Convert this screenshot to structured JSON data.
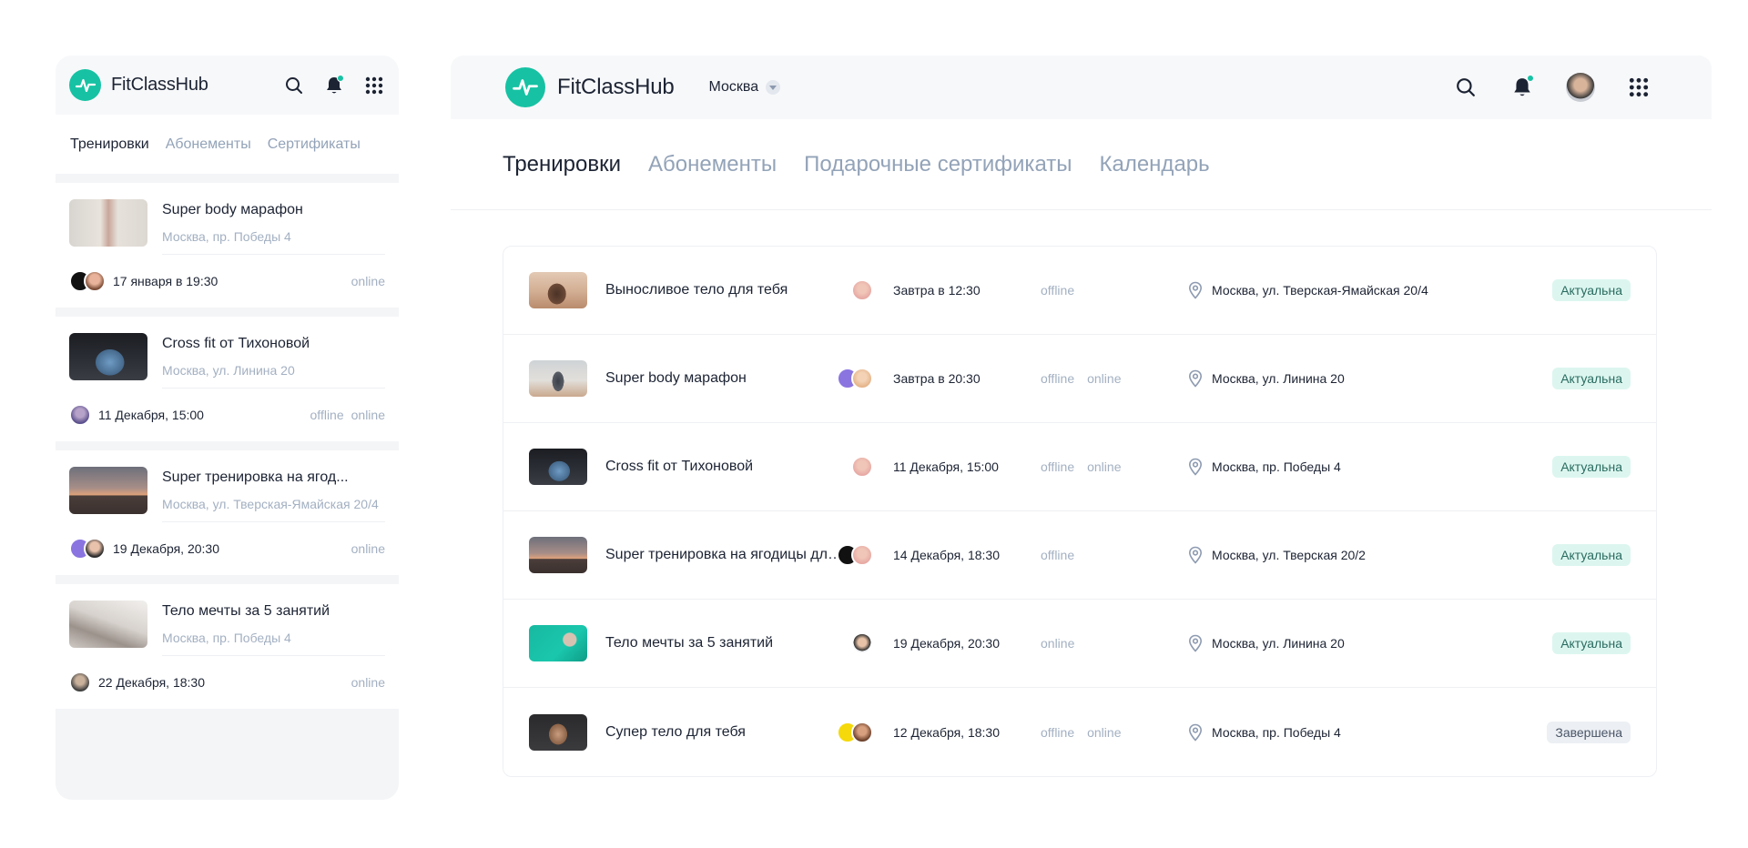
{
  "brand": {
    "name": "FitClassHub",
    "accent": "#16c2a3"
  },
  "icons": {
    "search": "search-icon",
    "bell": "bell-icon",
    "apps": "grid-icon",
    "location": "location-pin-icon",
    "caret": "chevron-down-icon"
  },
  "mobile": {
    "tabs": [
      {
        "label": "Тренировки",
        "active": true
      },
      {
        "label": "Абонементы",
        "active": false
      },
      {
        "label": "Сертификаты",
        "active": false
      }
    ],
    "items": [
      {
        "title": "Super body марафон",
        "address": "Москва, пр. Победы 4",
        "date": "17 января в 19:30",
        "modes": [
          "online"
        ]
      },
      {
        "title": "Cross fit от Тихоновой",
        "address": "Москва, ул. Линина 20",
        "date": "11 Декабря, 15:00",
        "modes": [
          "offline",
          "online"
        ]
      },
      {
        "title": "Super тренировка на ягод...",
        "address": "Москва, ул. Тверская-Ямайская 20/4",
        "date": "19 Декабря, 20:30",
        "modes": [
          "online"
        ]
      },
      {
        "title": "Тело мечты за 5 занятий",
        "address": "Москва, пр. Победы 4",
        "date": "22 Декабря, 18:30",
        "modes": [
          "online"
        ]
      }
    ]
  },
  "desktop": {
    "city": "Москва",
    "tabs": [
      {
        "label": "Тренировки",
        "active": true
      },
      {
        "label": "Абонементы",
        "active": false
      },
      {
        "label": "Подарочные сертификаты",
        "active": false
      },
      {
        "label": "Календарь",
        "active": false
      }
    ],
    "rows": [
      {
        "title": "Выносливое тело для тебя",
        "when": "Завтра в 12:30",
        "mode1": "offline",
        "mode2": "",
        "address": "Москва, ул. Тверская-Ямайская 20/4",
        "status": "Актуальна",
        "status_kind": "active"
      },
      {
        "title": "Super body марафон",
        "when": "Завтра в 20:30",
        "mode1": "offline",
        "mode2": "online",
        "address": "Москва, ул. Линина 20",
        "status": "Актуальна",
        "status_kind": "active"
      },
      {
        "title": "Cross fit от Тихоновой",
        "when": "11 Декабря, 15:00",
        "mode1": "offline",
        "mode2": "online",
        "address": "Москва, пр. Победы 4",
        "status": "Актуальна",
        "status_kind": "active"
      },
      {
        "title": "Super тренировка на ягодицы для...",
        "when": "14 Декабря, 18:30",
        "mode1": "offline",
        "mode2": "",
        "address": "Москва, ул. Тверская 20/2",
        "status": "Актуальна",
        "status_kind": "active"
      },
      {
        "title": "Тело мечты за 5 занятий",
        "when": "19 Декабря, 20:30",
        "mode1": "online",
        "mode2": "",
        "address": "Москва, ул. Линина 20",
        "status": "Актуальна",
        "status_kind": "active"
      },
      {
        "title": "Супер тело для тебя",
        "when": "12 Декабря, 18:30",
        "mode1": "offline",
        "mode2": "online",
        "address": "Москва, пр. Победы 4",
        "status": "Завершена",
        "status_kind": "done"
      }
    ]
  }
}
